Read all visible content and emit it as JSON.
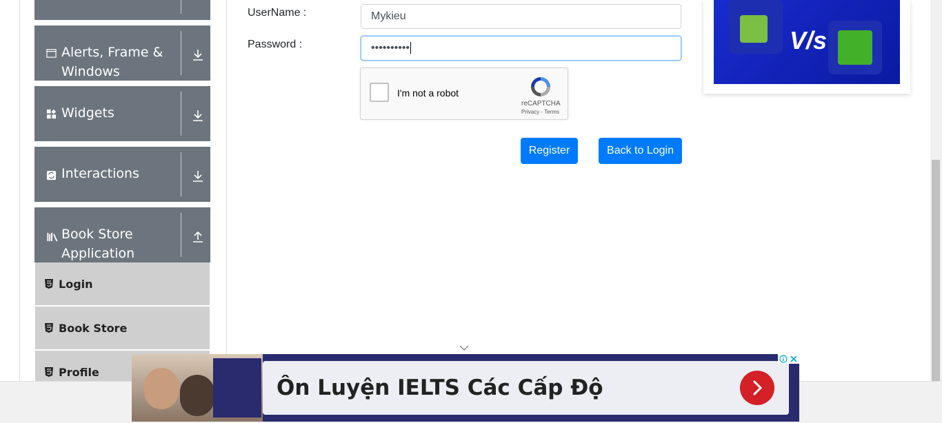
{
  "sidebar": {
    "groups": [
      {
        "label": "Alerts, Frame & Windows",
        "icon": "window-icon",
        "arrow": "download-arrow-icon"
      },
      {
        "label": "Widgets",
        "icon": "widgets-icon",
        "arrow": "download-arrow-icon"
      },
      {
        "label": "Interactions",
        "icon": "interactions-icon",
        "arrow": "download-arrow-icon"
      },
      {
        "label": "Book Store Application",
        "icon": "books-icon",
        "arrow": "upload-arrow-icon"
      }
    ],
    "book_store_items": [
      {
        "label": "Login"
      },
      {
        "label": "Book Store"
      },
      {
        "label": "Profile"
      }
    ]
  },
  "form": {
    "username_label": "UserName :",
    "username_value": "Mykieu",
    "password_label": "Password :",
    "password_value": "••••••••••",
    "captcha": {
      "label": "I'm not a robot",
      "brand": "reCAPTCHA",
      "links": "Privacy - Terms"
    },
    "register_label": "Register",
    "back_label": "Back to Login"
  },
  "ad_bottom": {
    "headline": "Ôn Luyện IELTS Các Cấp Độ"
  },
  "colors": {
    "sidebar_group": "#6c757d",
    "sidebar_item": "#cfcfcf",
    "primary_button": "#007bff",
    "ad_go": "#d42027"
  }
}
